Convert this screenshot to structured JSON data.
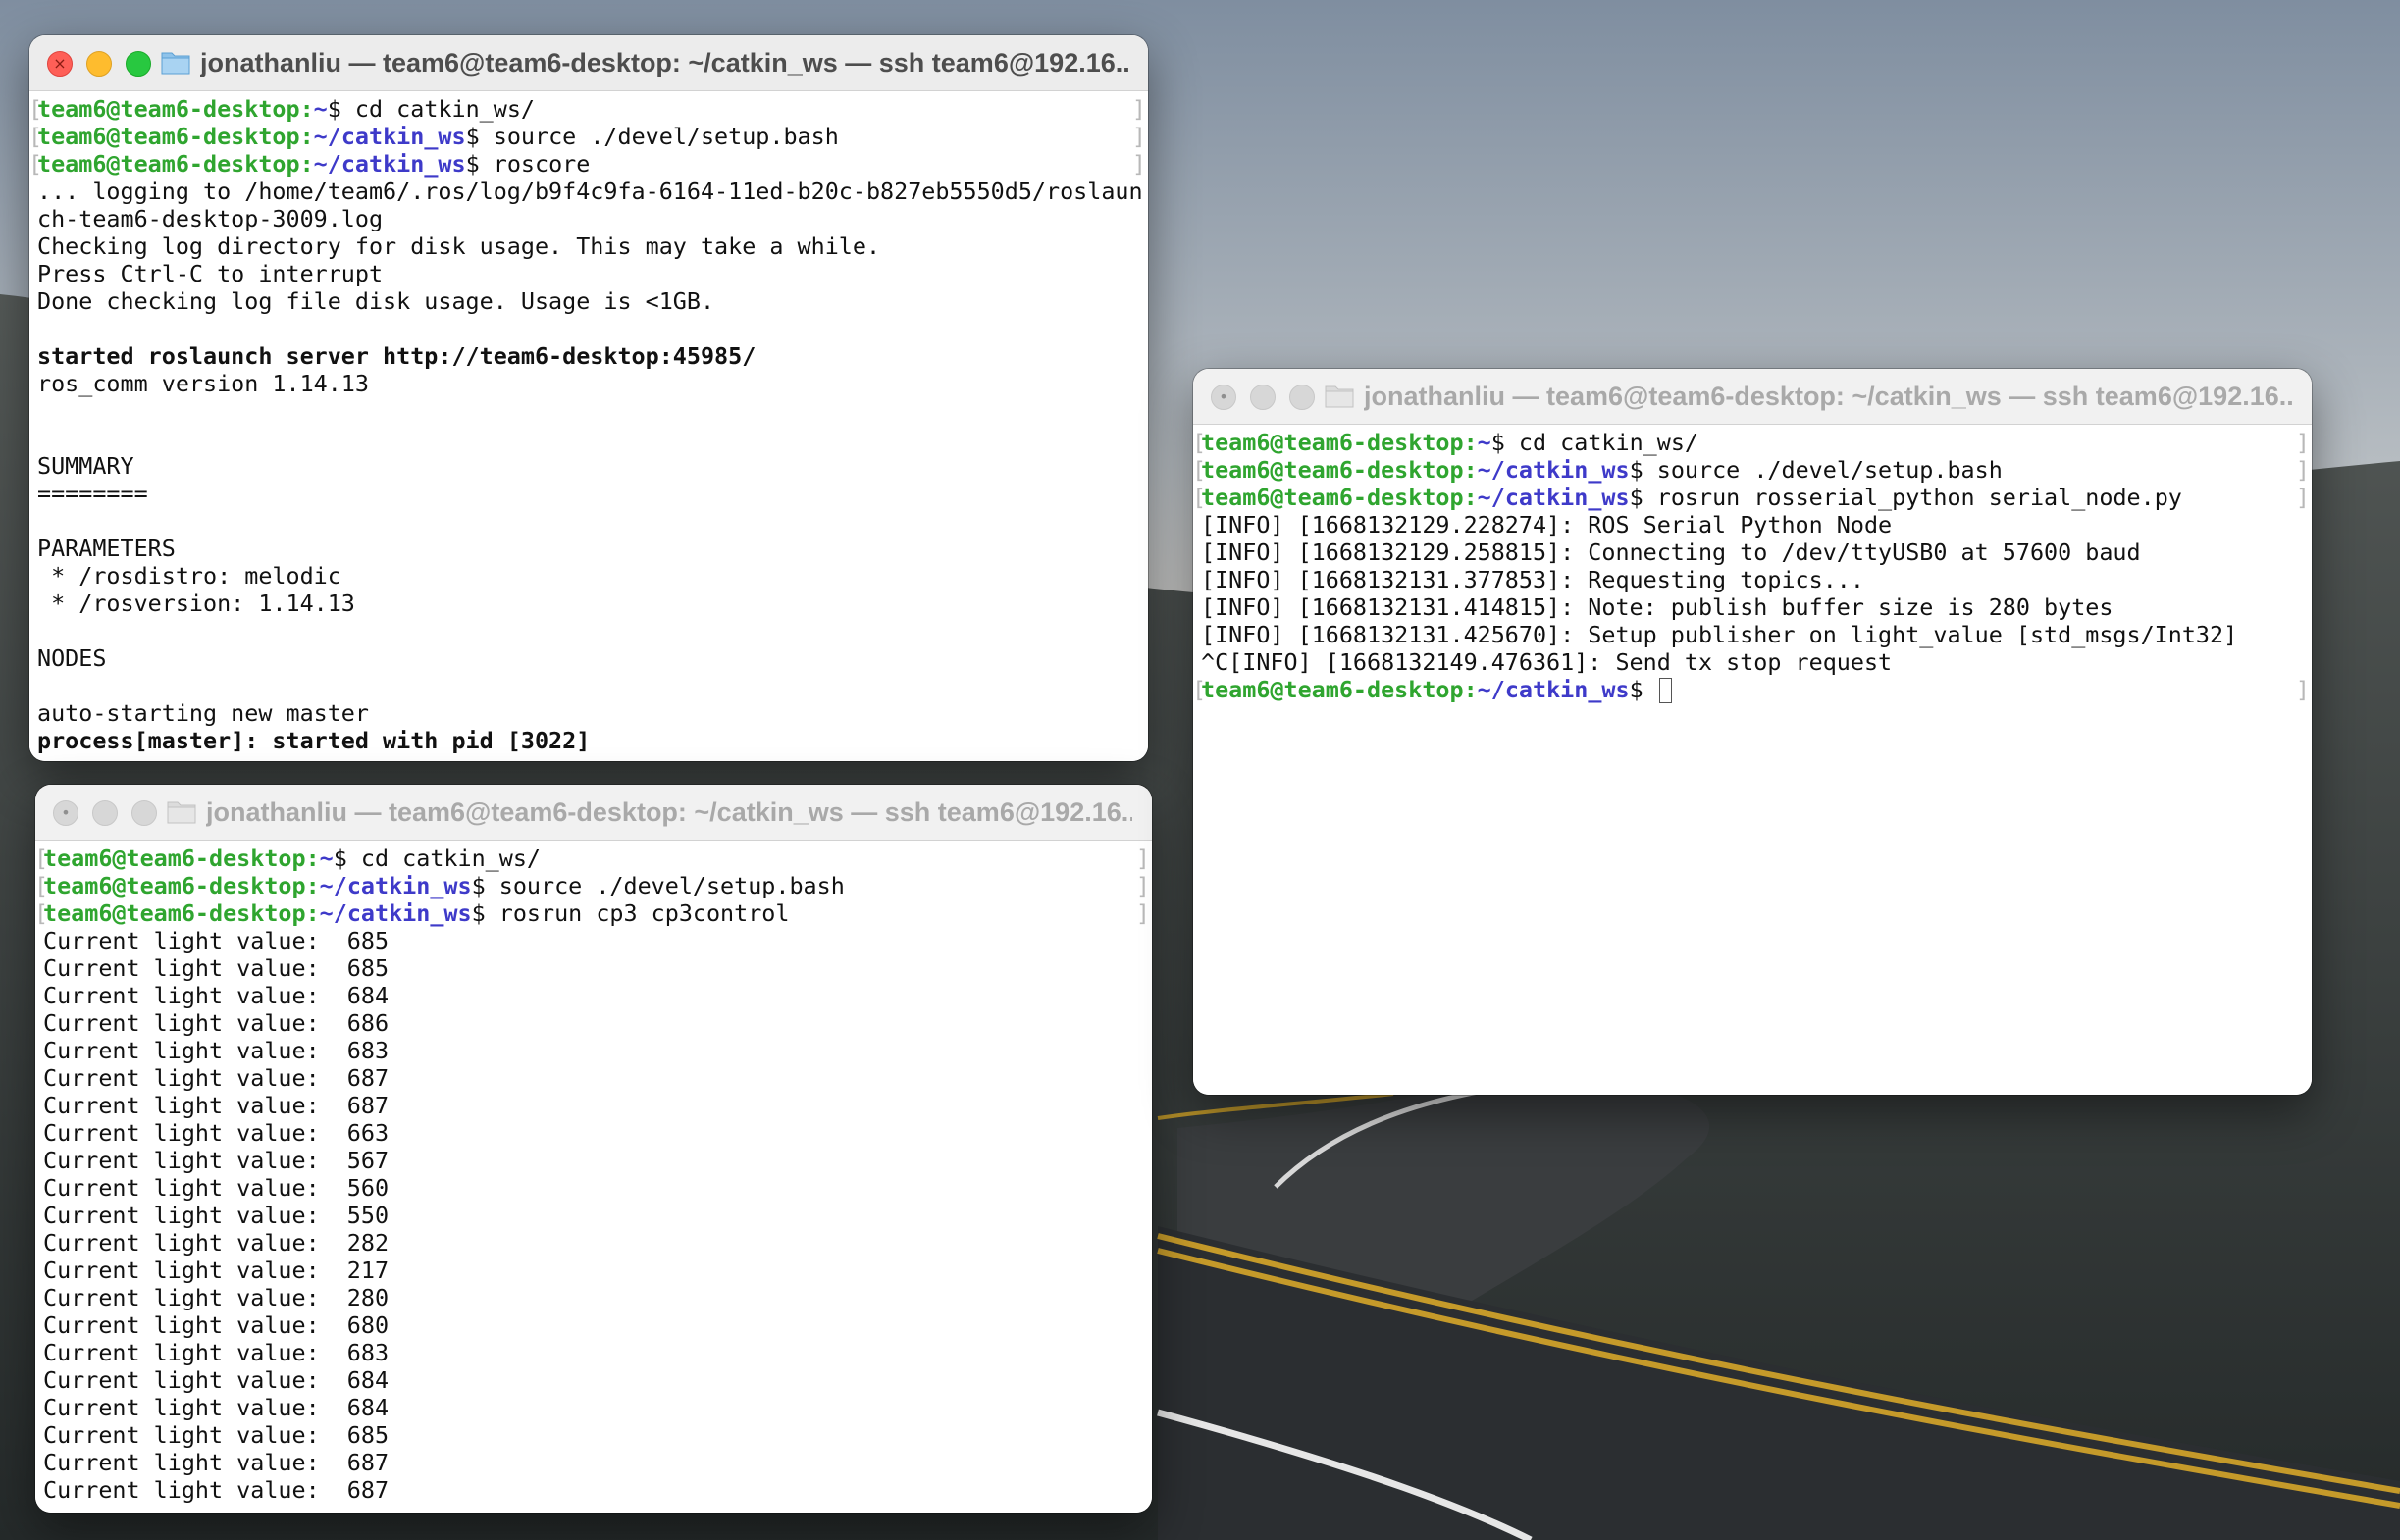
{
  "windows": [
    {
      "id": "win1",
      "title": "jonathanliu — team6@team6-desktop: ~/catkin_ws — ssh team6@192.16...",
      "active": true,
      "lines": [
        {
          "user": "team6@team6-desktop",
          "sep": ":",
          "path": "~",
          "cmd": "$ cd catkin_ws/"
        },
        {
          "user": "team6@team6-desktop",
          "sep": ":",
          "path": "~/catkin_ws",
          "cmd": "$ source ./devel/setup.bash"
        },
        {
          "user": "team6@team6-desktop",
          "sep": ":",
          "path": "~/catkin_ws",
          "cmd": "$ roscore"
        },
        {
          "text": "... logging to /home/team6/.ros/log/b9f4c9fa-6164-11ed-b20c-b827eb5550d5/roslaun"
        },
        {
          "text": "ch-team6-desktop-3009.log"
        },
        {
          "text": "Checking log directory for disk usage. This may take a while."
        },
        {
          "text": "Press Ctrl-C to interrupt"
        },
        {
          "text": "Done checking log file disk usage. Usage is <1GB."
        },
        {
          "text": ""
        },
        {
          "text": "started roslaunch server http://team6-desktop:45985/",
          "bold": true
        },
        {
          "text": "ros_comm version 1.14.13"
        },
        {
          "text": ""
        },
        {
          "text": ""
        },
        {
          "text": "SUMMARY"
        },
        {
          "text": "========"
        },
        {
          "text": ""
        },
        {
          "text": "PARAMETERS"
        },
        {
          "text": " * /rosdistro: melodic"
        },
        {
          "text": " * /rosversion: 1.14.13"
        },
        {
          "text": ""
        },
        {
          "text": "NODES"
        },
        {
          "text": ""
        },
        {
          "text": "auto-starting new master"
        },
        {
          "text": "process[master]: started with pid [3022]",
          "bold": true
        }
      ]
    },
    {
      "id": "win2",
      "title": "jonathanliu — team6@team6-desktop: ~/catkin_ws — ssh team6@192.16...",
      "active": false,
      "lines": [
        {
          "user": "team6@team6-desktop",
          "sep": ":",
          "path": "~",
          "cmd": "$ cd catkin_ws/"
        },
        {
          "user": "team6@team6-desktop",
          "sep": ":",
          "path": "~/catkin_ws",
          "cmd": "$ source ./devel/setup.bash"
        },
        {
          "user": "team6@team6-desktop",
          "sep": ":",
          "path": "~/catkin_ws",
          "cmd": "$ rosrun cp3 cp3control"
        },
        {
          "text": "Current light value:  685"
        },
        {
          "text": "Current light value:  685"
        },
        {
          "text": "Current light value:  684"
        },
        {
          "text": "Current light value:  686"
        },
        {
          "text": "Current light value:  683"
        },
        {
          "text": "Current light value:  687"
        },
        {
          "text": "Current light value:  687"
        },
        {
          "text": "Current light value:  663"
        },
        {
          "text": "Current light value:  567"
        },
        {
          "text": "Current light value:  560"
        },
        {
          "text": "Current light value:  550"
        },
        {
          "text": "Current light value:  282"
        },
        {
          "text": "Current light value:  217"
        },
        {
          "text": "Current light value:  280"
        },
        {
          "text": "Current light value:  680"
        },
        {
          "text": "Current light value:  683"
        },
        {
          "text": "Current light value:  684"
        },
        {
          "text": "Current light value:  684"
        },
        {
          "text": "Current light value:  685"
        },
        {
          "text": "Current light value:  687"
        },
        {
          "text": "Current light value:  687"
        }
      ]
    },
    {
      "id": "win3",
      "title": "jonathanliu — team6@team6-desktop: ~/catkin_ws — ssh team6@192.16...",
      "active": false,
      "lines": [
        {
          "user": "team6@team6-desktop",
          "sep": ":",
          "path": "~",
          "cmd": "$ cd catkin_ws/"
        },
        {
          "user": "team6@team6-desktop",
          "sep": ":",
          "path": "~/catkin_ws",
          "cmd": "$ source ./devel/setup.bash"
        },
        {
          "user": "team6@team6-desktop",
          "sep": ":",
          "path": "~/catkin_ws",
          "cmd": "$ rosrun rosserial_python serial_node.py"
        },
        {
          "text": "[INFO] [1668132129.228274]: ROS Serial Python Node"
        },
        {
          "text": "[INFO] [1668132129.258815]: Connecting to /dev/ttyUSB0 at 57600 baud"
        },
        {
          "text": "[INFO] [1668132131.377853]: Requesting topics..."
        },
        {
          "text": "[INFO] [1668132131.414815]: Note: publish buffer size is 280 bytes"
        },
        {
          "text": "[INFO] [1668132131.425670]: Setup publisher on light_value [std_msgs/Int32]"
        },
        {
          "text": "^C[INFO] [1668132149.476361]: Send tx stop request"
        },
        {
          "user": "team6@team6-desktop",
          "sep": ":",
          "path": "~/catkin_ws",
          "cmd": "$ ",
          "cursor": true
        }
      ]
    }
  ],
  "colors": {
    "prompt_user": "#2fa52f",
    "prompt_path": "#3e3ac9",
    "close": "#fe5f57",
    "minimize": "#febc2e",
    "zoom": "#28c840"
  },
  "icons": {
    "close": "close-icon",
    "minimize": "minimize-icon",
    "zoom": "zoom-icon",
    "folder": "folder-icon"
  }
}
